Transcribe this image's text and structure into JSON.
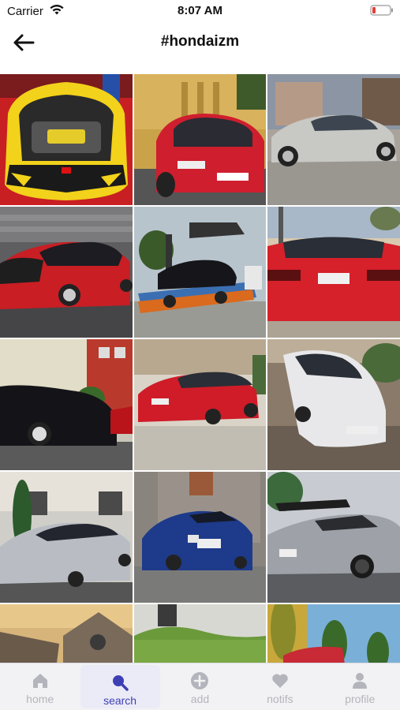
{
  "status_bar": {
    "carrier": "Carrier",
    "time": "8:07 AM",
    "battery_color": "#e0403a"
  },
  "header": {
    "title": "#hondaizm",
    "back_icon": "arrow-left-icon"
  },
  "grid": {
    "tiles": [
      {
        "desc": "yellow-civic-type-r-engine-bay"
      },
      {
        "desc": "red-civic-hatch-street"
      },
      {
        "desc": "silver-civic-sedan-road"
      },
      {
        "desc": "red-civic-sedan-dark"
      },
      {
        "desc": "black-civic-on-tow-truck"
      },
      {
        "desc": "red-civic-rear"
      },
      {
        "desc": "black-civic-hatch-street"
      },
      {
        "desc": "red-civic-sedan-parking"
      },
      {
        "desc": "white-civic-hatch"
      },
      {
        "desc": "silver-civic-sedan"
      },
      {
        "desc": "blue-civic-hatch-warehouse"
      },
      {
        "desc": "silver-s2000-convertible"
      },
      {
        "desc": "building-sunset"
      },
      {
        "desc": "grass-field"
      },
      {
        "desc": "red-car-trees"
      }
    ]
  },
  "tab_bar": {
    "accent_color": "#3f3fb5",
    "inactive_color": "#b4b4bc",
    "tabs": [
      {
        "label": "home",
        "icon": "home-icon",
        "active": false
      },
      {
        "label": "search",
        "icon": "search-icon",
        "active": true
      },
      {
        "label": "add",
        "icon": "add-icon",
        "active": false
      },
      {
        "label": "notifs",
        "icon": "heart-icon",
        "active": false
      },
      {
        "label": "profile",
        "icon": "profile-icon",
        "active": false
      }
    ]
  }
}
